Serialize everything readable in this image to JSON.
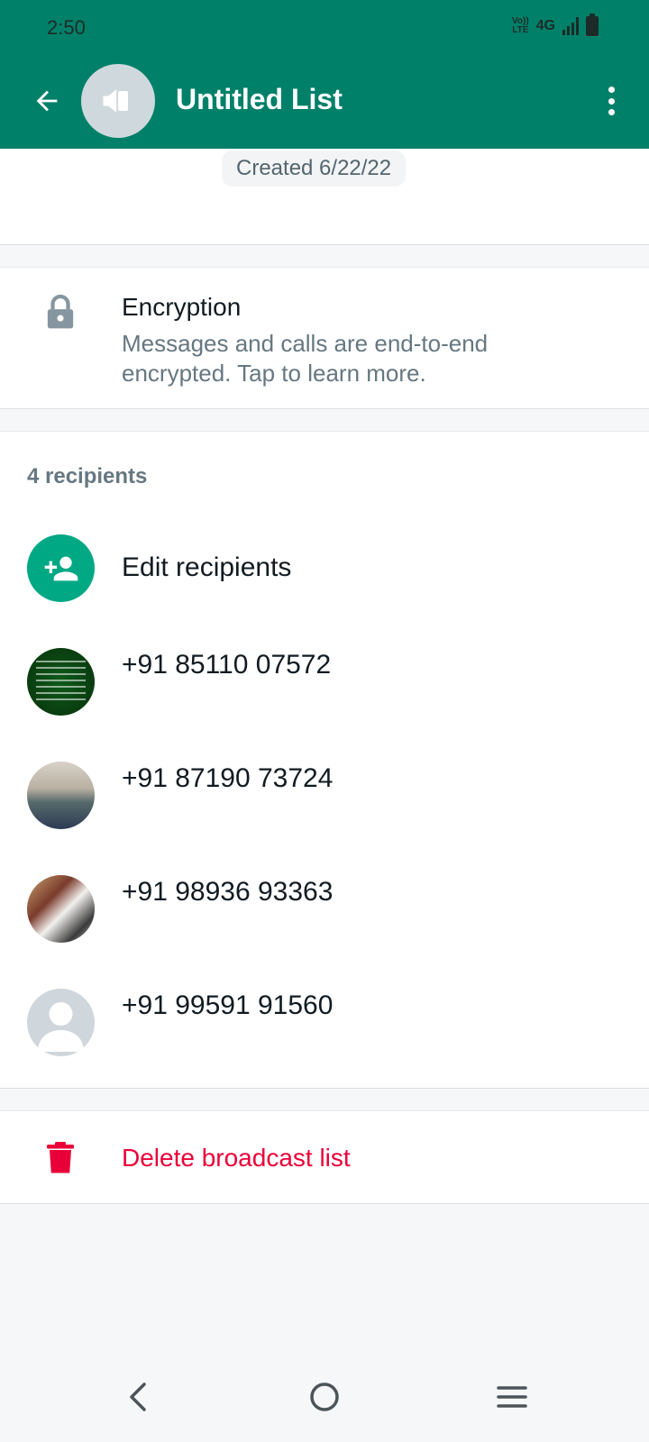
{
  "status_bar": {
    "time": "2:50",
    "network": "4G",
    "volte_label": "Vo))\nLTE"
  },
  "header": {
    "title": "Untitled List",
    "avatar_icon": "megaphone-icon",
    "back_icon": "arrow-back-icon",
    "menu_icon": "more-vert-icon",
    "bg_color": "#008069"
  },
  "created": {
    "text": "Created 6/22/22"
  },
  "encryption": {
    "title": "Encryption",
    "description": "Messages and calls are end-to-end encrypted. Tap to learn more.",
    "icon": "lock-icon"
  },
  "recipients": {
    "count_label": "4 recipients",
    "edit_label": "Edit recipients",
    "items": [
      {
        "phone": "+91 85110 07572"
      },
      {
        "phone": "+91 87190 73724"
      },
      {
        "phone": "+91 98936 93363"
      },
      {
        "phone": "+91 99591 91560"
      }
    ]
  },
  "delete": {
    "label": "Delete broadcast list",
    "icon": "trash-icon",
    "color": "#ea0038"
  },
  "nav": {
    "back_icon": "nav-back-icon",
    "home_icon": "nav-home-icon",
    "recents_icon": "nav-menu-icon"
  }
}
